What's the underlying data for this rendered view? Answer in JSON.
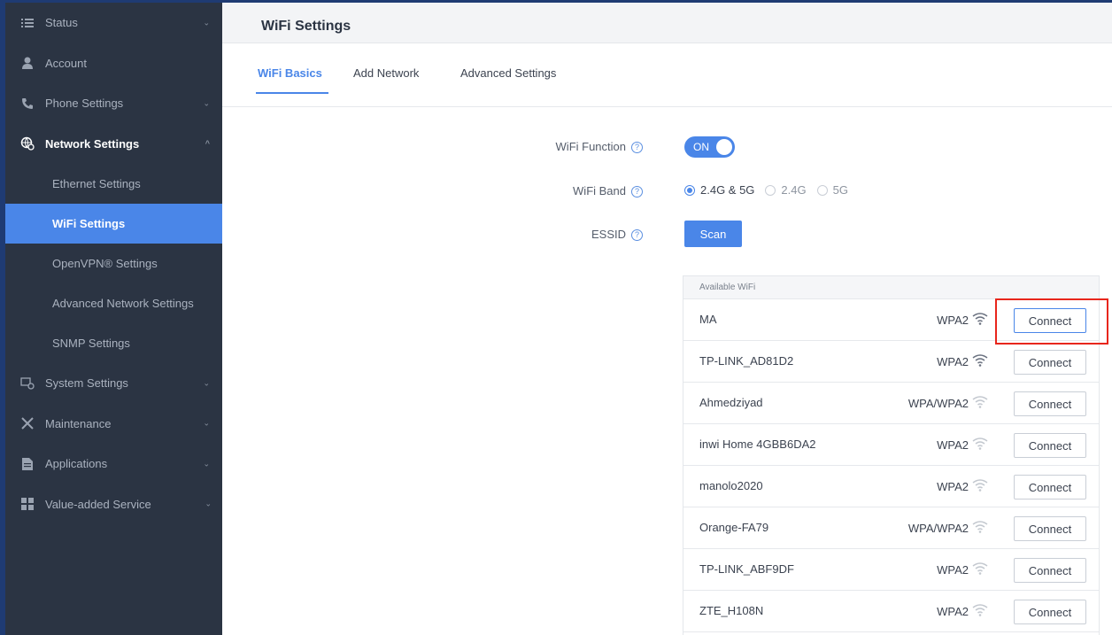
{
  "sidebar": {
    "items": [
      {
        "label": "Status",
        "icon": "list-icon",
        "chevron": "⌄"
      },
      {
        "label": "Account",
        "icon": "user-icon",
        "chevron": ""
      },
      {
        "label": "Phone Settings",
        "icon": "phone-icon",
        "chevron": "⌄"
      },
      {
        "label": "Network Settings",
        "icon": "network-icon",
        "chevron": "^"
      },
      {
        "label": "System Settings",
        "icon": "system-icon",
        "chevron": "⌄"
      },
      {
        "label": "Maintenance",
        "icon": "tools-icon",
        "chevron": "⌄"
      },
      {
        "label": "Applications",
        "icon": "document-icon",
        "chevron": "⌄"
      },
      {
        "label": "Value-added Service",
        "icon": "grid-icon",
        "chevron": "⌄"
      }
    ],
    "network_sub": [
      {
        "label": "Ethernet Settings"
      },
      {
        "label": "WiFi Settings"
      },
      {
        "label": "OpenVPN® Settings"
      },
      {
        "label": "Advanced Network Settings"
      },
      {
        "label": "SNMP Settings"
      }
    ]
  },
  "header": {
    "title": "WiFi Settings"
  },
  "tabs": [
    {
      "label": "WiFi Basics"
    },
    {
      "label": "Add Network"
    },
    {
      "label": "Advanced Settings"
    }
  ],
  "form": {
    "wifi_function_label": "WiFi Function",
    "wifi_function_value": "ON",
    "wifi_band_label": "WiFi Band",
    "band_options": [
      {
        "label": "2.4G & 5G",
        "checked": true
      },
      {
        "label": "2.4G",
        "checked": false
      },
      {
        "label": "5G",
        "checked": false
      }
    ],
    "essid_label": "ESSID",
    "scan_label": "Scan",
    "help_glyph": "?"
  },
  "wifi": {
    "header": "Available WiFi",
    "connect_label": "Connect",
    "networks": [
      {
        "ssid": "MA",
        "security": "WPA2",
        "signal": "strong"
      },
      {
        "ssid": "TP-LINK_AD81D2",
        "security": "WPA2",
        "signal": "strong"
      },
      {
        "ssid": "Ahmedziyad",
        "security": "WPA/WPA2",
        "signal": "weak"
      },
      {
        "ssid": "inwi Home 4GBB6DA2",
        "security": "WPA2",
        "signal": "weak"
      },
      {
        "ssid": "manolo2020",
        "security": "WPA2",
        "signal": "weak"
      },
      {
        "ssid": "Orange-FA79",
        "security": "WPA/WPA2",
        "signal": "weak"
      },
      {
        "ssid": "TP-LINK_ABF9DF",
        "security": "WPA2",
        "signal": "weak"
      },
      {
        "ssid": "ZTE_H108N",
        "security": "WPA2",
        "signal": "weak"
      }
    ]
  },
  "colors": {
    "accent": "#4a86e8",
    "sidebar_bg": "#2b3443",
    "highlight": "#e8261c"
  }
}
